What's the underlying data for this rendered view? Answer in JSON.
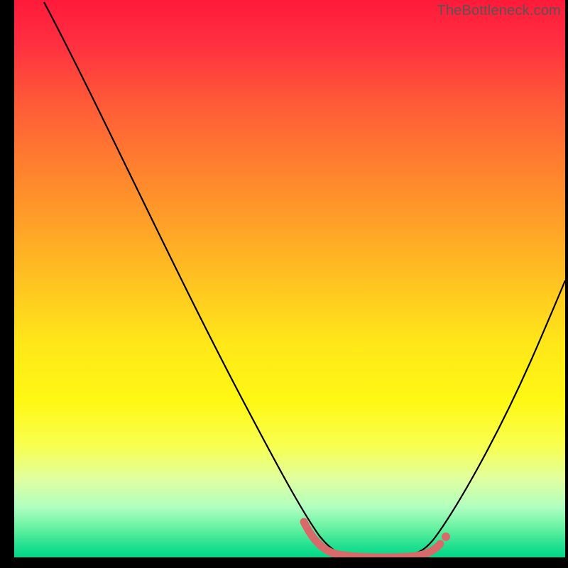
{
  "watermark": "TheBottleneck.com",
  "chart_data": {
    "type": "line",
    "title": "",
    "xlabel": "",
    "ylabel": "",
    "xlim": [
      0,
      100
    ],
    "ylim": [
      0,
      100
    ],
    "x": [
      0,
      5,
      10,
      15,
      20,
      25,
      30,
      35,
      40,
      45,
      50,
      55,
      58,
      60,
      62,
      65,
      70,
      75,
      78,
      80,
      85,
      90,
      95,
      100
    ],
    "values": [
      100,
      92,
      83,
      74,
      65,
      56,
      47,
      38,
      29,
      21,
      13,
      6,
      2,
      1,
      0.5,
      0.3,
      0.2,
      0.5,
      1,
      3,
      12,
      25,
      40,
      54
    ],
    "series": [
      {
        "name": "bottleneck-curve",
        "color": "#000000",
        "x": [
          0,
          5,
          10,
          15,
          20,
          25,
          30,
          35,
          40,
          45,
          50,
          55,
          58,
          60,
          62,
          65,
          70,
          75,
          78,
          80,
          85,
          90,
          95,
          100
        ],
        "y": [
          100,
          92,
          83,
          74,
          65,
          56,
          47,
          38,
          29,
          21,
          13,
          6,
          2,
          1,
          0.5,
          0.3,
          0.2,
          0.5,
          1,
          3,
          12,
          25,
          40,
          54
        ]
      },
      {
        "name": "optimal-zone-marker",
        "color": "#d86a6a",
        "x": [
          52,
          55,
          58,
          60,
          62,
          65,
          70,
          75,
          77,
          78
        ],
        "y": [
          8,
          4,
          2,
          1,
          0.5,
          0.3,
          0.2,
          0.5,
          1,
          2
        ]
      }
    ],
    "background": "heat-gradient-vertical",
    "gradient_stops": [
      {
        "pos": 0,
        "color": "#ff1a3a"
      },
      {
        "pos": 50,
        "color": "#ffd020"
      },
      {
        "pos": 85,
        "color": "#f0ff90"
      },
      {
        "pos": 100,
        "color": "#00d888"
      }
    ]
  }
}
